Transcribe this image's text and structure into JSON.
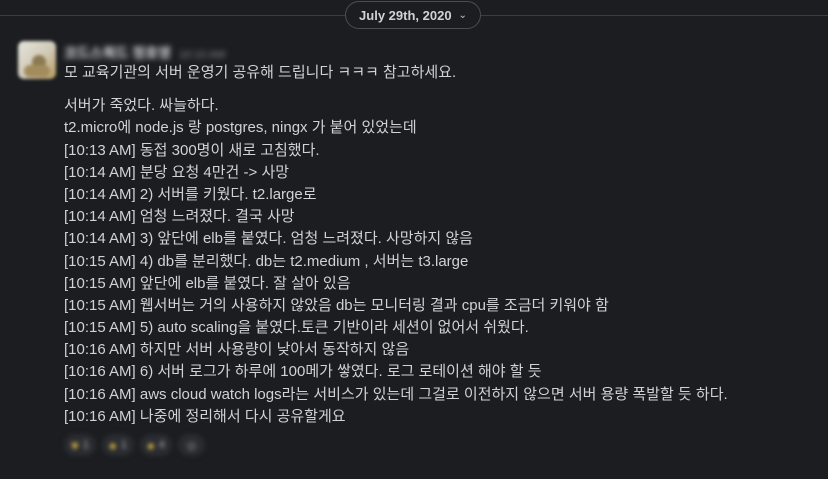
{
  "date_divider": {
    "label": "July 29th, 2020",
    "chevron": "chevron-down-icon"
  },
  "message": {
    "sender_name": "코드스쿼드 정호영",
    "timestamp": "10:10 AM",
    "lines": [
      "모 교육기관의 서버 운영기 공유해 드립니다 ㅋㅋㅋ 참고하세요.",
      "",
      "서버가 죽었다. 싸늘하다.",
      "t2.micro에 node.js 랑 postgres, ningx 가 붙어 있었는데",
      "[10:13 AM] 동접 300명이 새로 고침했다.",
      "[10:14 AM] 분당 요청 4만건 -> 사망",
      "[10:14 AM] 2) 서버를 키웠다. t2.large로",
      "[10:14 AM] 엄청 느려졌다. 결국 사망",
      "[10:14 AM] 3) 앞단에 elb를 붙였다. 엄청 느려졌다. 사망하지 않음",
      "[10:15 AM] 4) db를 분리했다. db는 t2.medium , 서버는 t3.large",
      "[10:15 AM] 앞단에 elb를 붙였다. 잘 살아 있음",
      "[10:15 AM] 웹서버는 거의 사용하지 않았음 db는 모니터링 결과 cpu를 조금더 키워야 함",
      "[10:15 AM] 5) auto scaling을 붙였다.토큰 기반이라 세션이 없어서 쉬웠다.",
      "[10:16 AM] 하지만 서버 사용량이 낮아서 동작하지 않음",
      "[10:16 AM] 6) 서버 로그가 하루에 100메가 쌓였다. 로그 로테이션 해야 할 듯",
      "[10:16 AM] aws cloud watch logs라는 서비스가 있는데 그걸로 이전하지 않으면 서버 용량 폭발할 듯 하다.",
      "[10:16 AM] 나중에 정리해서 다시 공유할게요"
    ]
  },
  "reactions": [
    {
      "icon": "emoji-icon",
      "glyph": "♥",
      "count": "1"
    },
    {
      "icon": "emoji-icon",
      "glyph": "●",
      "count": "1"
    },
    {
      "icon": "emoji-icon",
      "glyph": "●",
      "count": "4"
    },
    {
      "icon": "add-reaction-icon",
      "glyph": "☺",
      "count": ""
    }
  ]
}
